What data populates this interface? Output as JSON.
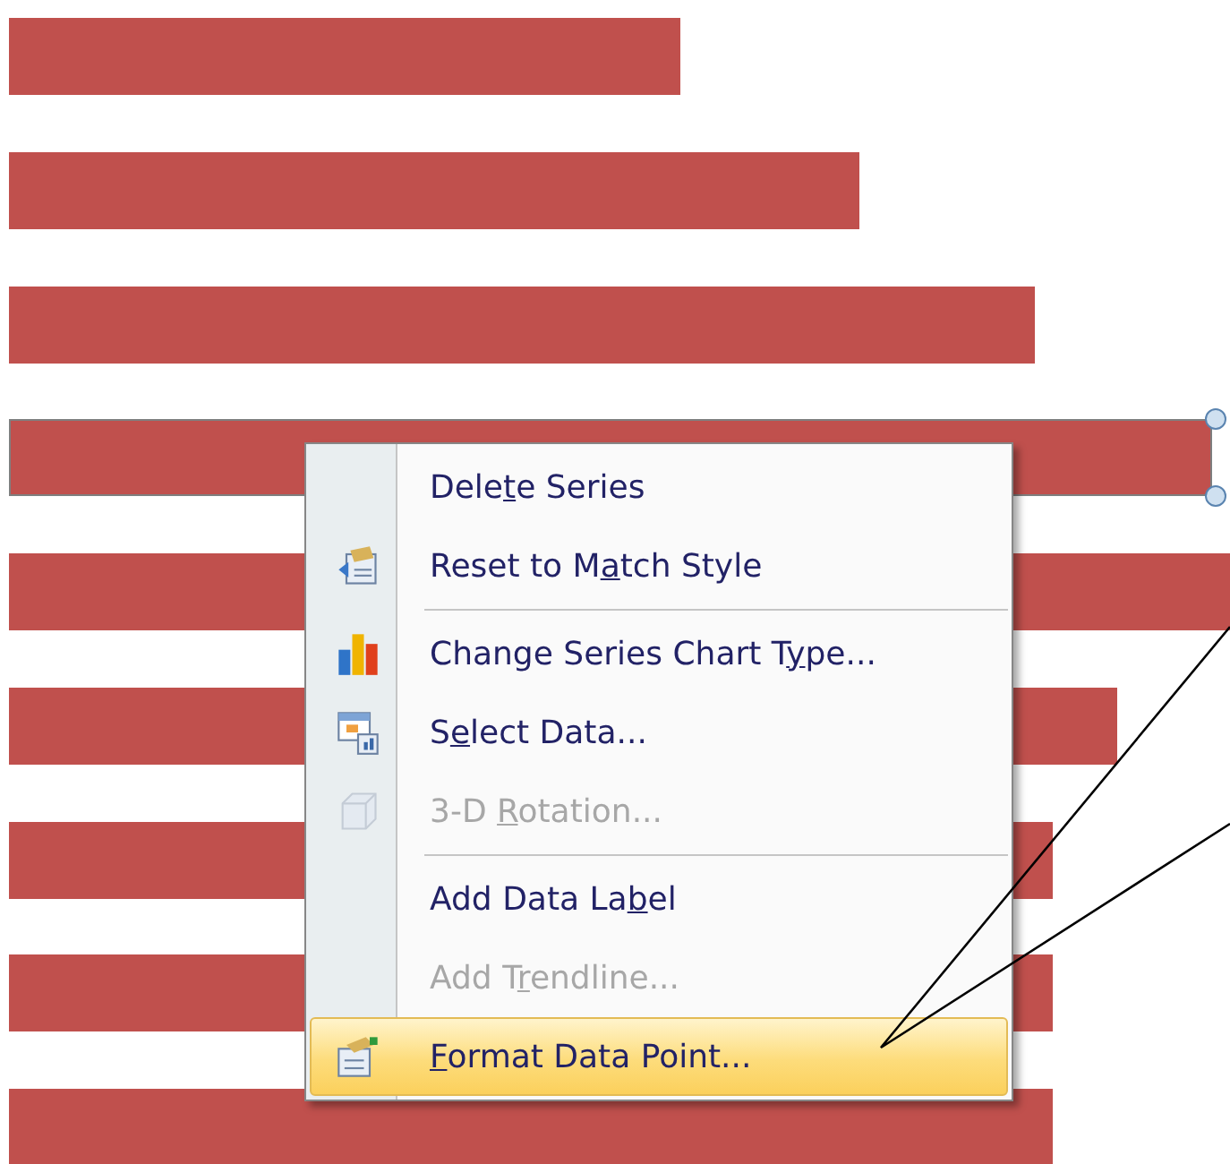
{
  "chart": {
    "bars": [
      {
        "selected": false
      },
      {
        "selected": false
      },
      {
        "selected": false
      },
      {
        "selected": true
      },
      {
        "selected": false
      },
      {
        "selected": false
      },
      {
        "selected": false
      },
      {
        "selected": false
      },
      {
        "selected": false
      }
    ]
  },
  "context_menu": {
    "items": [
      {
        "kind": "item",
        "label_parts": [
          "Dele",
          "t",
          "e Series"
        ],
        "disabled": false,
        "selected": false
      },
      {
        "kind": "item",
        "label_parts": [
          "Reset to M",
          "a",
          "tch Style"
        ],
        "disabled": false,
        "selected": false
      },
      {
        "kind": "separator"
      },
      {
        "kind": "item",
        "label_parts": [
          "Change Series Chart T",
          "y",
          "pe..."
        ],
        "disabled": false,
        "selected": false
      },
      {
        "kind": "item",
        "label_parts": [
          "S",
          "e",
          "lect Data..."
        ],
        "disabled": false,
        "selected": false
      },
      {
        "kind": "item",
        "label_parts": [
          "3-D ",
          "R",
          "otation..."
        ],
        "disabled": true,
        "selected": false
      },
      {
        "kind": "separator"
      },
      {
        "kind": "item",
        "label_parts": [
          "Add Data La",
          "b",
          "el"
        ],
        "disabled": false,
        "selected": false
      },
      {
        "kind": "item",
        "label_parts": [
          "Add T",
          "r",
          "endline..."
        ],
        "disabled": true,
        "selected": false
      },
      {
        "kind": "item",
        "label_parts": [
          "F",
          "ormat Data Point..."
        ],
        "key_first": true,
        "disabled": false,
        "selected": true
      }
    ]
  }
}
